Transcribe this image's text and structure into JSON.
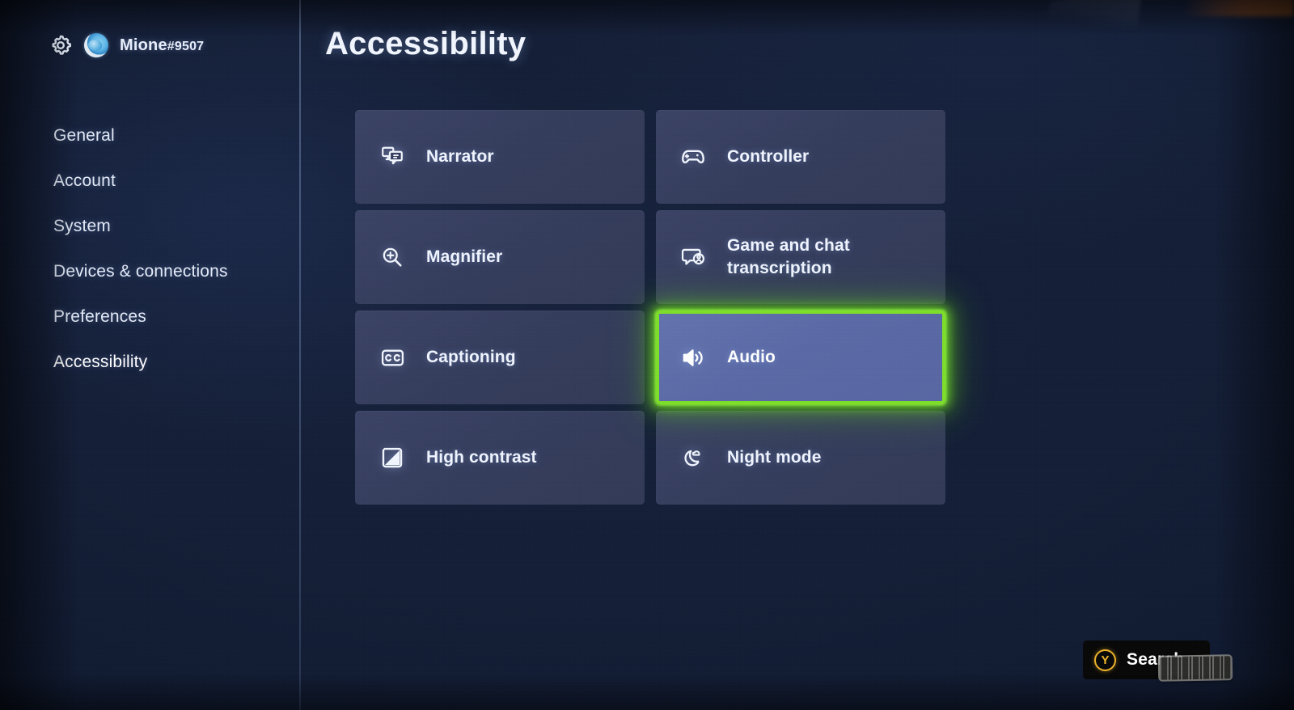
{
  "account": {
    "gear_icon": "gear-icon",
    "avatar_icon": "avatar",
    "gamertag_name": "Mione",
    "gamertag_suffix": "#9507"
  },
  "sidebar": {
    "items": [
      {
        "label": "General",
        "active": false
      },
      {
        "label": "Account",
        "active": false
      },
      {
        "label": "System",
        "active": false
      },
      {
        "label": "Devices & connections",
        "active": false
      },
      {
        "label": "Preferences",
        "active": false
      },
      {
        "label": "Accessibility",
        "active": true
      }
    ]
  },
  "header": {
    "title": "Accessibility"
  },
  "tiles": [
    {
      "label": "Narrator",
      "icon": "narrator-icon",
      "selected": false
    },
    {
      "label": "Controller",
      "icon": "controller-icon",
      "selected": false
    },
    {
      "label": "Magnifier",
      "icon": "magnifier-icon",
      "selected": false
    },
    {
      "label": "Game and chat\ntranscription",
      "icon": "transcription-icon",
      "selected": false
    },
    {
      "label": "Captioning",
      "icon": "captioning-icon",
      "selected": false
    },
    {
      "label": "Audio",
      "icon": "audio-icon",
      "selected": true
    },
    {
      "label": "High contrast",
      "icon": "high-contrast-icon",
      "selected": false
    },
    {
      "label": "Night mode",
      "icon": "night-mode-icon",
      "selected": false
    }
  ],
  "footer": {
    "search_label": "Search",
    "search_button_glyph": "Y"
  },
  "colors": {
    "background": "#141e36",
    "tile_fill": "#363f5e",
    "tile_selected_fill": "#5b6aa6",
    "focus_green": "#7ee02a",
    "text": "#f0f5ff",
    "y_button_yellow": "#f0b429"
  }
}
